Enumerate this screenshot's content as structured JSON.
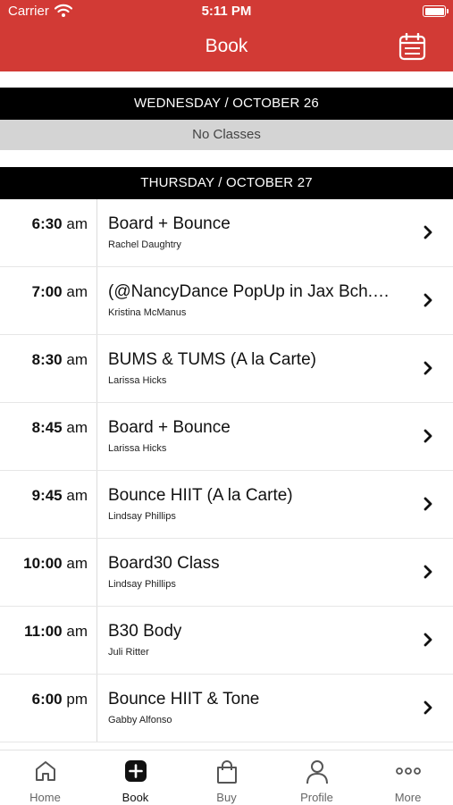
{
  "status_bar": {
    "carrier": "Carrier",
    "time": "5:11 PM"
  },
  "header": {
    "title": "Book",
    "accent_color": "#d23a35"
  },
  "days": [
    {
      "label": "WEDNESDAY / OCTOBER 26",
      "empty_text": "No Classes"
    },
    {
      "label": "THURSDAY / OCTOBER 27"
    }
  ],
  "classes": [
    {
      "time": "6:30",
      "ampm": "am",
      "name": "Board + Bounce",
      "instructor": "Rachel Daughtry"
    },
    {
      "time": "7:00",
      "ampm": "am",
      "name": "(@NancyDance PopUp in Jax Bch.…",
      "instructor": "Kristina McManus"
    },
    {
      "time": "8:30",
      "ampm": "am",
      "name": "BUMS & TUMS (A la Carte)",
      "instructor": "Larissa Hicks"
    },
    {
      "time": "8:45",
      "ampm": "am",
      "name": "Board + Bounce",
      "instructor": "Larissa Hicks"
    },
    {
      "time": "9:45",
      "ampm": "am",
      "name": "Bounce HIIT (A la Carte)",
      "instructor": "Lindsay Phillips"
    },
    {
      "time": "10:00",
      "ampm": "am",
      "name": "Board30 Class",
      "instructor": "Lindsay Phillips"
    },
    {
      "time": "11:00",
      "ampm": "am",
      "name": "B30 Body",
      "instructor": "Juli Ritter"
    },
    {
      "time": "6:00",
      "ampm": "pm",
      "name": "Bounce HIIT & Tone",
      "instructor": "Gabby Alfonso"
    }
  ],
  "tabs": [
    {
      "label": "Home",
      "icon": "home-icon"
    },
    {
      "label": "Book",
      "icon": "plus-square-icon"
    },
    {
      "label": "Buy",
      "icon": "shopping-bag-icon"
    },
    {
      "label": "Profile",
      "icon": "person-icon"
    },
    {
      "label": "More",
      "icon": "more-dots-icon"
    }
  ]
}
